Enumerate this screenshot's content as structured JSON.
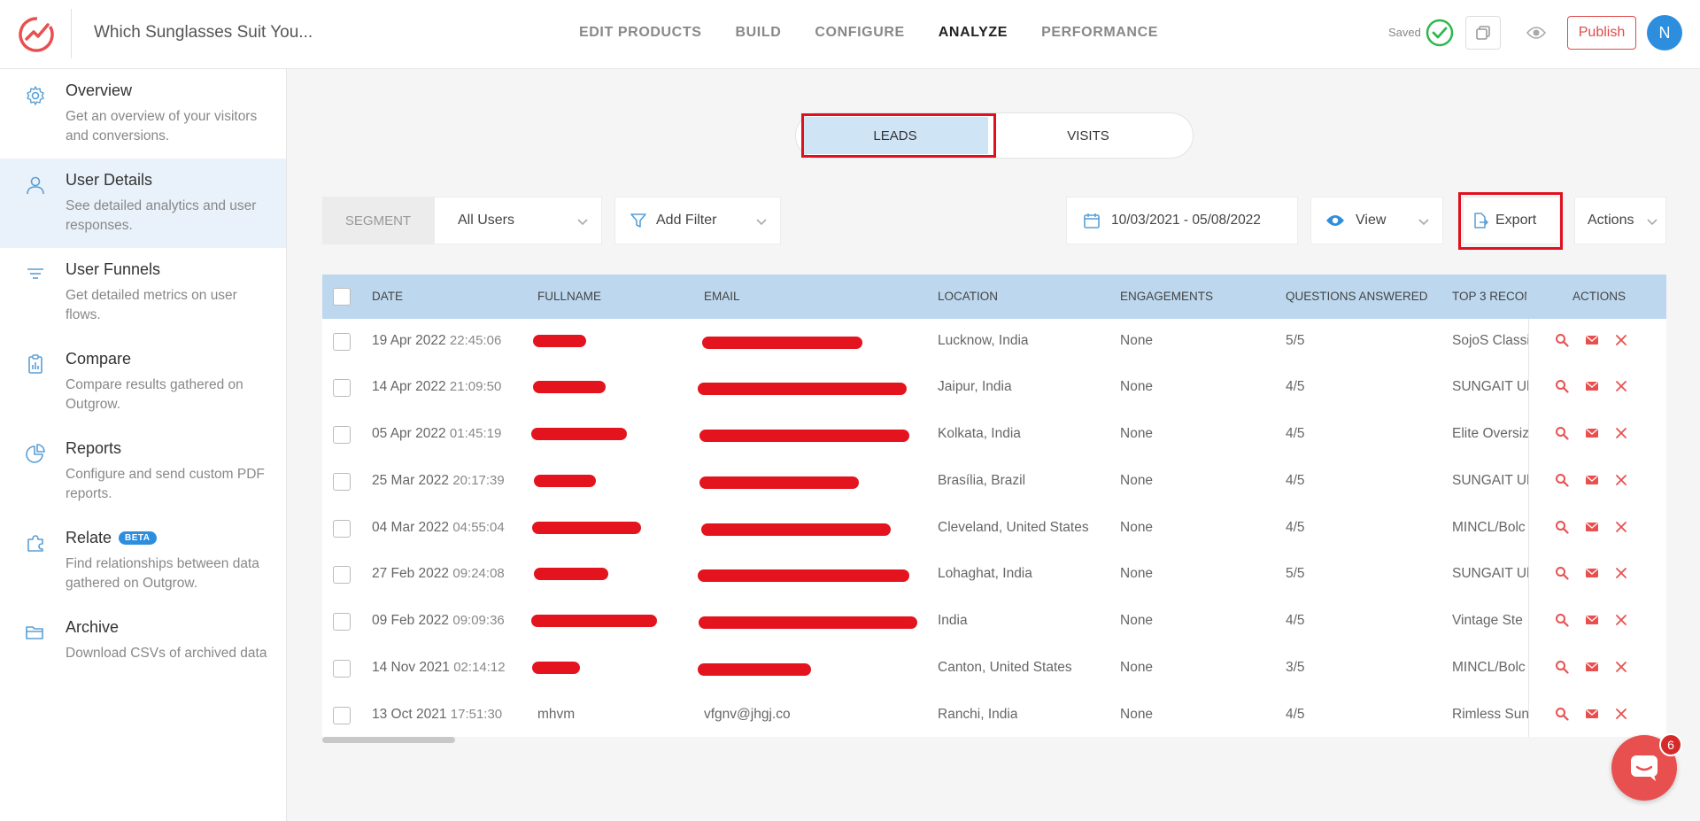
{
  "app": {
    "title": "Which Sunglasses Suit You..."
  },
  "nav": [
    "EDIT PRODUCTS",
    "BUILD",
    "CONFIGURE",
    "ANALYZE",
    "PERFORMANCE"
  ],
  "nav_active": "ANALYZE",
  "status": {
    "saved": "Saved"
  },
  "header_buttons": {
    "publish": "Publish",
    "avatar_initial": "N"
  },
  "sidebar": {
    "items": [
      {
        "title": "Overview",
        "desc": "Get an overview of your visitors and conversions."
      },
      {
        "title": "User Details",
        "desc": "See detailed analytics and user responses."
      },
      {
        "title": "User Funnels",
        "desc": "Get detailed metrics on user flows."
      },
      {
        "title": "Compare",
        "desc": "Compare results gathered on Outgrow."
      },
      {
        "title": "Reports",
        "desc": "Configure and send custom PDF reports."
      },
      {
        "title": "Relate",
        "desc": "Find relationships between data gathered on Outgrow.",
        "badge": "BETA"
      },
      {
        "title": "Archive",
        "desc": "Download CSVs of archived data"
      }
    ],
    "active_index": 1
  },
  "toggle": {
    "leads": "LEADS",
    "visits": "VISITS",
    "active": "LEADS"
  },
  "filters": {
    "segment": "SEGMENT",
    "users": "All Users",
    "add_filter": "Add Filter",
    "date_range": "10/03/2021 - 05/08/2022",
    "view": "View",
    "export": "Export",
    "actions": "Actions"
  },
  "table": {
    "columns": [
      "DATE",
      "FULLNAME",
      "EMAIL",
      "LOCATION",
      "ENGAGEMENTS",
      "QUESTIONS ANSWERED",
      "TOP 3 RECOM",
      "ACTIONS"
    ],
    "rows": [
      {
        "date": "19 Apr 2022",
        "time": "22:45:06",
        "fullname": "",
        "email": "",
        "location": "Lucknow, India",
        "engagements": "None",
        "answered": "5/5",
        "top3": "SojoS Classi"
      },
      {
        "date": "14 Apr 2022",
        "time": "21:09:50",
        "fullname": "",
        "email": "",
        "location": "Jaipur, India",
        "engagements": "None",
        "answered": "4/5",
        "top3": "SUNGAIT Ul"
      },
      {
        "date": "05 Apr 2022",
        "time": "01:45:19",
        "fullname": "",
        "email": "",
        "location": "Kolkata, India",
        "engagements": "None",
        "answered": "4/5",
        "top3": "Elite Oversiz"
      },
      {
        "date": "25 Mar 2022",
        "time": "20:17:39",
        "fullname": "",
        "email": "",
        "location": "Brasília, Brazil",
        "engagements": "None",
        "answered": "4/5",
        "top3": "SUNGAIT Ul"
      },
      {
        "date": "04 Mar 2022",
        "time": "04:55:04",
        "fullname": "",
        "email": "",
        "location": "Cleveland, United States",
        "engagements": "None",
        "answered": "4/5",
        "top3": "MINCL/Bolc"
      },
      {
        "date": "27 Feb 2022",
        "time": "09:24:08",
        "fullname": "",
        "email": "",
        "location": "Lohaghat, India",
        "engagements": "None",
        "answered": "5/5",
        "top3": "SUNGAIT Ul"
      },
      {
        "date": "09 Feb 2022",
        "time": "09:09:36",
        "fullname": "",
        "email": "",
        "location": "India",
        "engagements": "None",
        "answered": "4/5",
        "top3": "Vintage Ste"
      },
      {
        "date": "14 Nov 2021",
        "time": "02:14:12",
        "fullname": "",
        "email": "",
        "location": "Canton, United States",
        "engagements": "None",
        "answered": "3/5",
        "top3": "MINCL/Bolc"
      },
      {
        "date": "13 Oct 2021",
        "time": "17:51:30",
        "fullname": "mhvm",
        "email": "vfgnv@jhgj.co",
        "location": "Ranchi, India",
        "engagements": "None",
        "answered": "4/5",
        "top3": "Rimless Sun"
      }
    ]
  },
  "chat": {
    "badge_count": "6"
  },
  "colors": {
    "accent": "#2e8ede",
    "brand_red": "#e8504f",
    "header_blue": "#bdd8ee",
    "annotation_red": "#e0101e"
  }
}
